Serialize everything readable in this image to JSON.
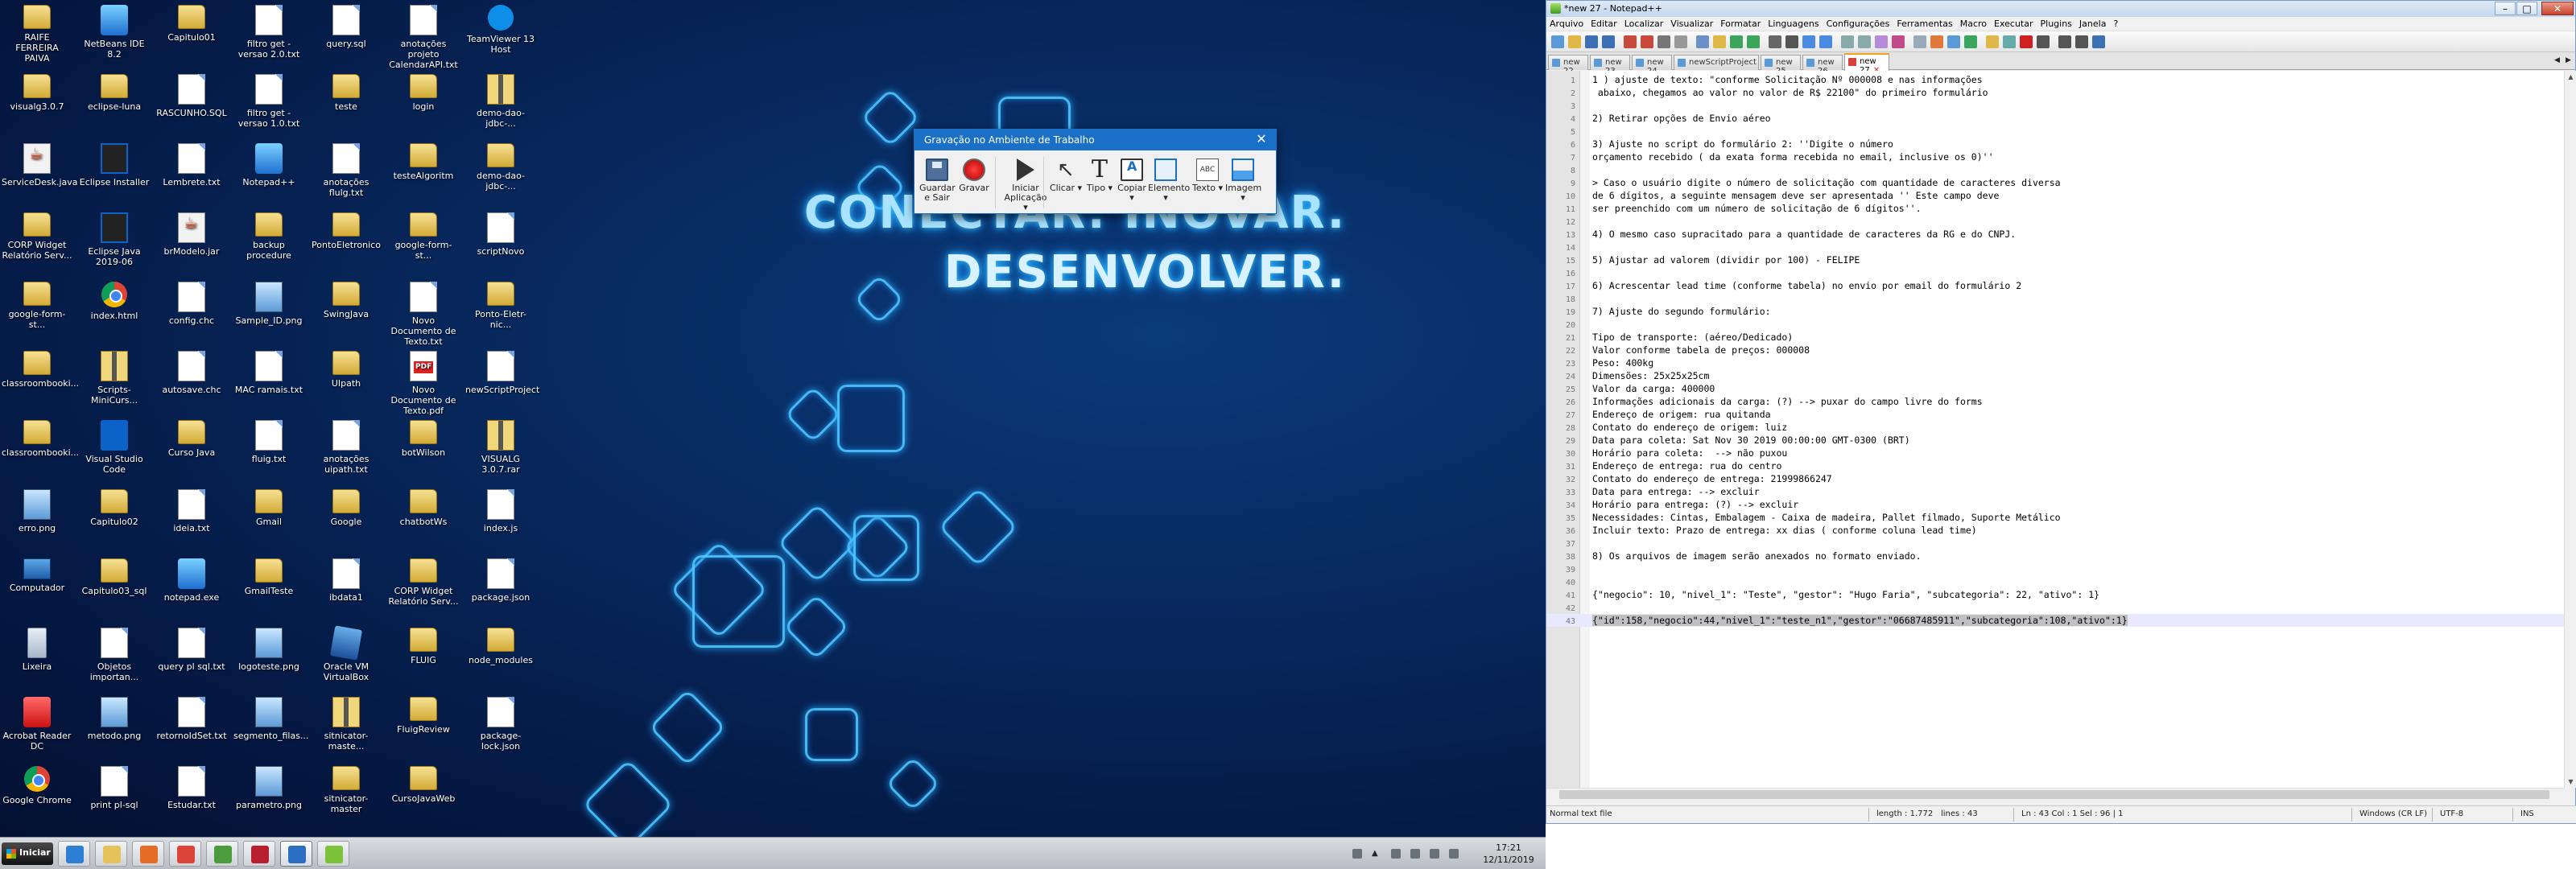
{
  "desktop": {
    "wallpaper": {
      "line1": "CONECTAR. INOVAR.",
      "line2": "DESENVOLVER."
    },
    "icons": [
      {
        "label": "RAIFE FERREIRA PAIVA",
        "icon": "folder-icon"
      },
      {
        "label": "NetBeans IDE 8.2",
        "icon": "netbeans-icon"
      },
      {
        "label": "Capitulo01",
        "icon": "folder-icon"
      },
      {
        "label": "filtro get - versao 2.0.txt",
        "icon": "text-file-icon"
      },
      {
        "label": "query.sql",
        "icon": "sql-file-icon"
      },
      {
        "label": "anotações projeto CalendarAPI.txt",
        "icon": "text-file-icon"
      },
      {
        "label": "TeamViewer 13 Host",
        "icon": "teamviewer-icon"
      },
      {
        "label": "visualg3.0.7",
        "icon": "folder-icon"
      },
      {
        "label": "eclipse-luna",
        "icon": "folder-icon"
      },
      {
        "label": "RASCUNHO.SQL",
        "icon": "sql-file-icon"
      },
      {
        "label": "filtro get - versao 1.0.txt",
        "icon": "text-file-icon"
      },
      {
        "label": "teste",
        "icon": "folder-icon"
      },
      {
        "label": "login",
        "icon": "folder-icon"
      },
      {
        "label": "demo-dao-jdbc-...",
        "icon": "zip-icon"
      },
      {
        "label": "ServiceDesk.java",
        "icon": "java-file-icon"
      },
      {
        "label": "Eclipse Installer",
        "icon": "eclipse-icon"
      },
      {
        "label": "Lembrete.txt",
        "icon": "text-file-icon"
      },
      {
        "label": "Notepad++",
        "icon": "notepadpp-icon"
      },
      {
        "label": "anotações flulg.txt",
        "icon": "text-file-icon"
      },
      {
        "label": "testeAlgoritm",
        "icon": "folder-icon"
      },
      {
        "label": "demo-dao-jdbc-...",
        "icon": "folder-icon"
      },
      {
        "label": "CORP Widget Relatório Serv...",
        "icon": "folder-icon"
      },
      {
        "label": "Eclipse Java 2019-06",
        "icon": "eclipse-icon"
      },
      {
        "label": "brModelo.jar",
        "icon": "java-file-icon"
      },
      {
        "label": "backup procedure",
        "icon": "folder-icon"
      },
      {
        "label": "PontoEletronico",
        "icon": "folder-icon"
      },
      {
        "label": "google-form-st...",
        "icon": "folder-icon"
      },
      {
        "label": "scriptNovo",
        "icon": "text-file-icon"
      },
      {
        "label": "google-form-st...",
        "icon": "folder-icon"
      },
      {
        "label": "index.html",
        "icon": "chrome-icon"
      },
      {
        "label": "config.chc",
        "icon": "text-file-icon"
      },
      {
        "label": "Sample_ID.png",
        "icon": "image-icon"
      },
      {
        "label": "SwingJava",
        "icon": "folder-icon"
      },
      {
        "label": "Novo Documento de Texto.txt",
        "icon": "text-file-icon"
      },
      {
        "label": "Ponto-Eletr-nic...",
        "icon": "folder-icon"
      },
      {
        "label": "classroombooki...",
        "icon": "folder-icon"
      },
      {
        "label": "Scripts-MiniCurs...",
        "icon": "zip-icon"
      },
      {
        "label": "autosave.chc",
        "icon": "text-file-icon"
      },
      {
        "label": "MAC ramais.txt",
        "icon": "text-file-icon"
      },
      {
        "label": "UIpath",
        "icon": "folder-icon"
      },
      {
        "label": "Novo Documento de Texto.pdf",
        "icon": "pdf-icon"
      },
      {
        "label": "newScriptProject",
        "icon": "text-file-icon"
      },
      {
        "label": "classroombooki...",
        "icon": "folder-icon"
      },
      {
        "label": "Visual Studio Code",
        "icon": "vscode-icon"
      },
      {
        "label": "Curso Java",
        "icon": "folder-icon"
      },
      {
        "label": "fluig.txt",
        "icon": "text-file-icon"
      },
      {
        "label": "anotações uipath.txt",
        "icon": "text-file-icon"
      },
      {
        "label": "botWilson",
        "icon": "folder-icon"
      },
      {
        "label": "VISUALG 3.0.7.rar",
        "icon": "zip-icon"
      },
      {
        "label": "erro.png",
        "icon": "image-icon"
      },
      {
        "label": "Capitulo02",
        "icon": "folder-icon"
      },
      {
        "label": "ideia.txt",
        "icon": "text-file-icon"
      },
      {
        "label": "Gmail",
        "icon": "folder-icon"
      },
      {
        "label": "Google",
        "icon": "folder-icon"
      },
      {
        "label": "chatbotWs",
        "icon": "folder-icon"
      },
      {
        "label": "index.js",
        "icon": "js-file-icon"
      },
      {
        "label": "Computador",
        "icon": "computer-icon"
      },
      {
        "label": "Capitulo03_sql",
        "icon": "folder-icon"
      },
      {
        "label": "notepad.exe",
        "icon": "notepad-exe-icon"
      },
      {
        "label": "GmailTeste",
        "icon": "folder-icon"
      },
      {
        "label": "ibdata1",
        "icon": "text-file-icon"
      },
      {
        "label": "CORP Widget Relatório Serv...",
        "icon": "folder-icon"
      },
      {
        "label": "package.json",
        "icon": "json-file-icon"
      },
      {
        "label": "Lixeira",
        "icon": "recycle-bin-icon"
      },
      {
        "label": "Objetos importan...",
        "icon": "text-file-icon"
      },
      {
        "label": "query pl sql.txt",
        "icon": "text-file-icon"
      },
      {
        "label": "logoteste.png",
        "icon": "image-icon"
      },
      {
        "label": "Oracle VM VirtualBox",
        "icon": "virtualbox-icon"
      },
      {
        "label": "FLUIG",
        "icon": "folder-icon"
      },
      {
        "label": "node_modules",
        "icon": "folder-icon"
      },
      {
        "label": "Acrobat Reader DC",
        "icon": "acrobat-icon"
      },
      {
        "label": "metodo.png",
        "icon": "image-icon"
      },
      {
        "label": "retornoIdSet.txt",
        "icon": "text-file-icon"
      },
      {
        "label": "segmento_filas...",
        "icon": "image-icon"
      },
      {
        "label": "sitnicator-maste...",
        "icon": "zip-icon"
      },
      {
        "label": "FluigReview",
        "icon": "folder-icon"
      },
      {
        "label": "package-lock.json",
        "icon": "json-file-icon"
      },
      {
        "label": "Google Chrome",
        "icon": "chrome-icon"
      },
      {
        "label": "print pl-sql",
        "icon": "text-file-icon"
      },
      {
        "label": "Estudar.txt",
        "icon": "text-file-icon"
      },
      {
        "label": "parametro.png",
        "icon": "image-icon"
      },
      {
        "label": "sitnicator-master",
        "icon": "folder-icon"
      },
      {
        "label": "CursoJavaWeb",
        "icon": "folder-icon"
      }
    ]
  },
  "rec_dialog": {
    "title": "Gravação no Ambiente de Trabalho",
    "tools": [
      {
        "label": "Guardar e Sair",
        "icon": "save-icon"
      },
      {
        "label": "Gravar",
        "icon": "record-icon"
      },
      {
        "label": "Iniciar Aplicação ▾",
        "icon": "play-icon"
      },
      {
        "label": "Clicar ▾",
        "icon": "cursor-icon"
      },
      {
        "label": "Tipo ▾",
        "icon": "type-icon"
      },
      {
        "label": "Copiar ▾",
        "icon": "copy-icon"
      },
      {
        "label": "Elemento ▾",
        "icon": "element-icon"
      },
      {
        "label": "Texto ▾",
        "icon": "text-icon"
      },
      {
        "label": "Imagem ▾",
        "icon": "image-icon"
      }
    ]
  },
  "taskbar": {
    "start_label": "Iniciar",
    "apps": [
      "internet-explorer-icon",
      "file-explorer-icon",
      "media-player-icon",
      "chrome-icon",
      "network-icon",
      "database-icon",
      "uipath-icon",
      "notepadpp-icon"
    ],
    "clock_time": "17:21",
    "clock_date": "12/11/2019"
  },
  "npp": {
    "title": "*new 27 - Notepad++",
    "menu": [
      "Arquivo",
      "Editar",
      "Localizar",
      "Visualizar",
      "Formatar",
      "Linguagens",
      "Configurações",
      "Ferramentas",
      "Macro",
      "Executar",
      "Plugins",
      "Janela",
      "?"
    ],
    "tabs": [
      "new 22",
      "new 23",
      "new 24",
      "newScriptProject",
      "new 25",
      "new 26",
      "new 27"
    ],
    "lines": [
      "1 ) ajuste de texto: \"conforme Solicitação Nº 000008 e nas informações",
      " abaixo, chegamos ao valor no valor de R$ 22100\" do primeiro formulário",
      "",
      "2) Retirar opções de Envio aéreo",
      "",
      "3) Ajuste no script do formulário 2: ''Digite o número",
      "orçamento recebido ( da exata forma recebida no email, inclusive os 0)''",
      "",
      "> Caso o usuário digite o número de solicitação com quantidade de caracteres diversa",
      "de 6 dígitos, a seguinte mensagem deve ser apresentada '' Este campo deve",
      "ser preenchido com um número de solicitação de 6 dígitos''.",
      "",
      "4) O mesmo caso supracitado para a quantidade de caracteres da RG e do CNPJ.",
      "",
      "5) Ajustar ad valorem (dividir por 100) - FELIPE",
      "",
      "6) Acrescentar lead time (conforme tabela) no envio por email do formulário 2",
      "",
      "7) Ajuste do segundo formulário:",
      "",
      "Tipo de transporte: (aéreo/Dedicado)",
      "Valor conforme tabela de preços: 000008",
      "Peso: 400kg",
      "Dimensões: 25x25x25cm",
      "Valor da carga: 400000",
      "Informações adicionais da carga: (?) --> puxar do campo livre do forms",
      "Endereço de origem: rua quitanda",
      "Contato do endereço de origem: luiz",
      "Data para coleta: Sat Nov 30 2019 00:00:00 GMT-0300 (BRT)",
      "Horário para coleta:  --> não puxou",
      "Endereço de entrega: rua do centro",
      "Contato do endereço de entrega: 21999866247",
      "Data para entrega: --> excluir",
      "Horário para entrega: (?) --> excluir",
      "Necessidades: Cintas, Embalagem - Caixa de madeira, Pallet filmado, Suporte Metálico",
      "Incluir texto: Prazo de entrega: xx dias ( conforme coluna lead time)",
      "",
      "8) Os arquivos de imagem serão anexados no formato enviado.",
      "",
      "",
      "{\"negocio\": 10, \"nivel_1\": \"Teste\", \"gestor\": \"Hugo Faria\", \"subcategoria\": 22, \"ativo\": 1}",
      "",
      "{\"id\":158,\"negocio\":44,\"nivel_1\":\"teste_n1\",\"gestor\":\"06687485911\",\"subcategoria\":108,\"ativo\":1}"
    ],
    "current_line": 43,
    "status": {
      "filetype": "Normal text file",
      "length": "length : 1.772",
      "lines": "lines : 43",
      "position": "Ln : 43    Col : 1    Sel : 96 | 1",
      "eol": "Windows (CR LF)",
      "encoding": "UTF-8",
      "mode": "INS"
    }
  }
}
